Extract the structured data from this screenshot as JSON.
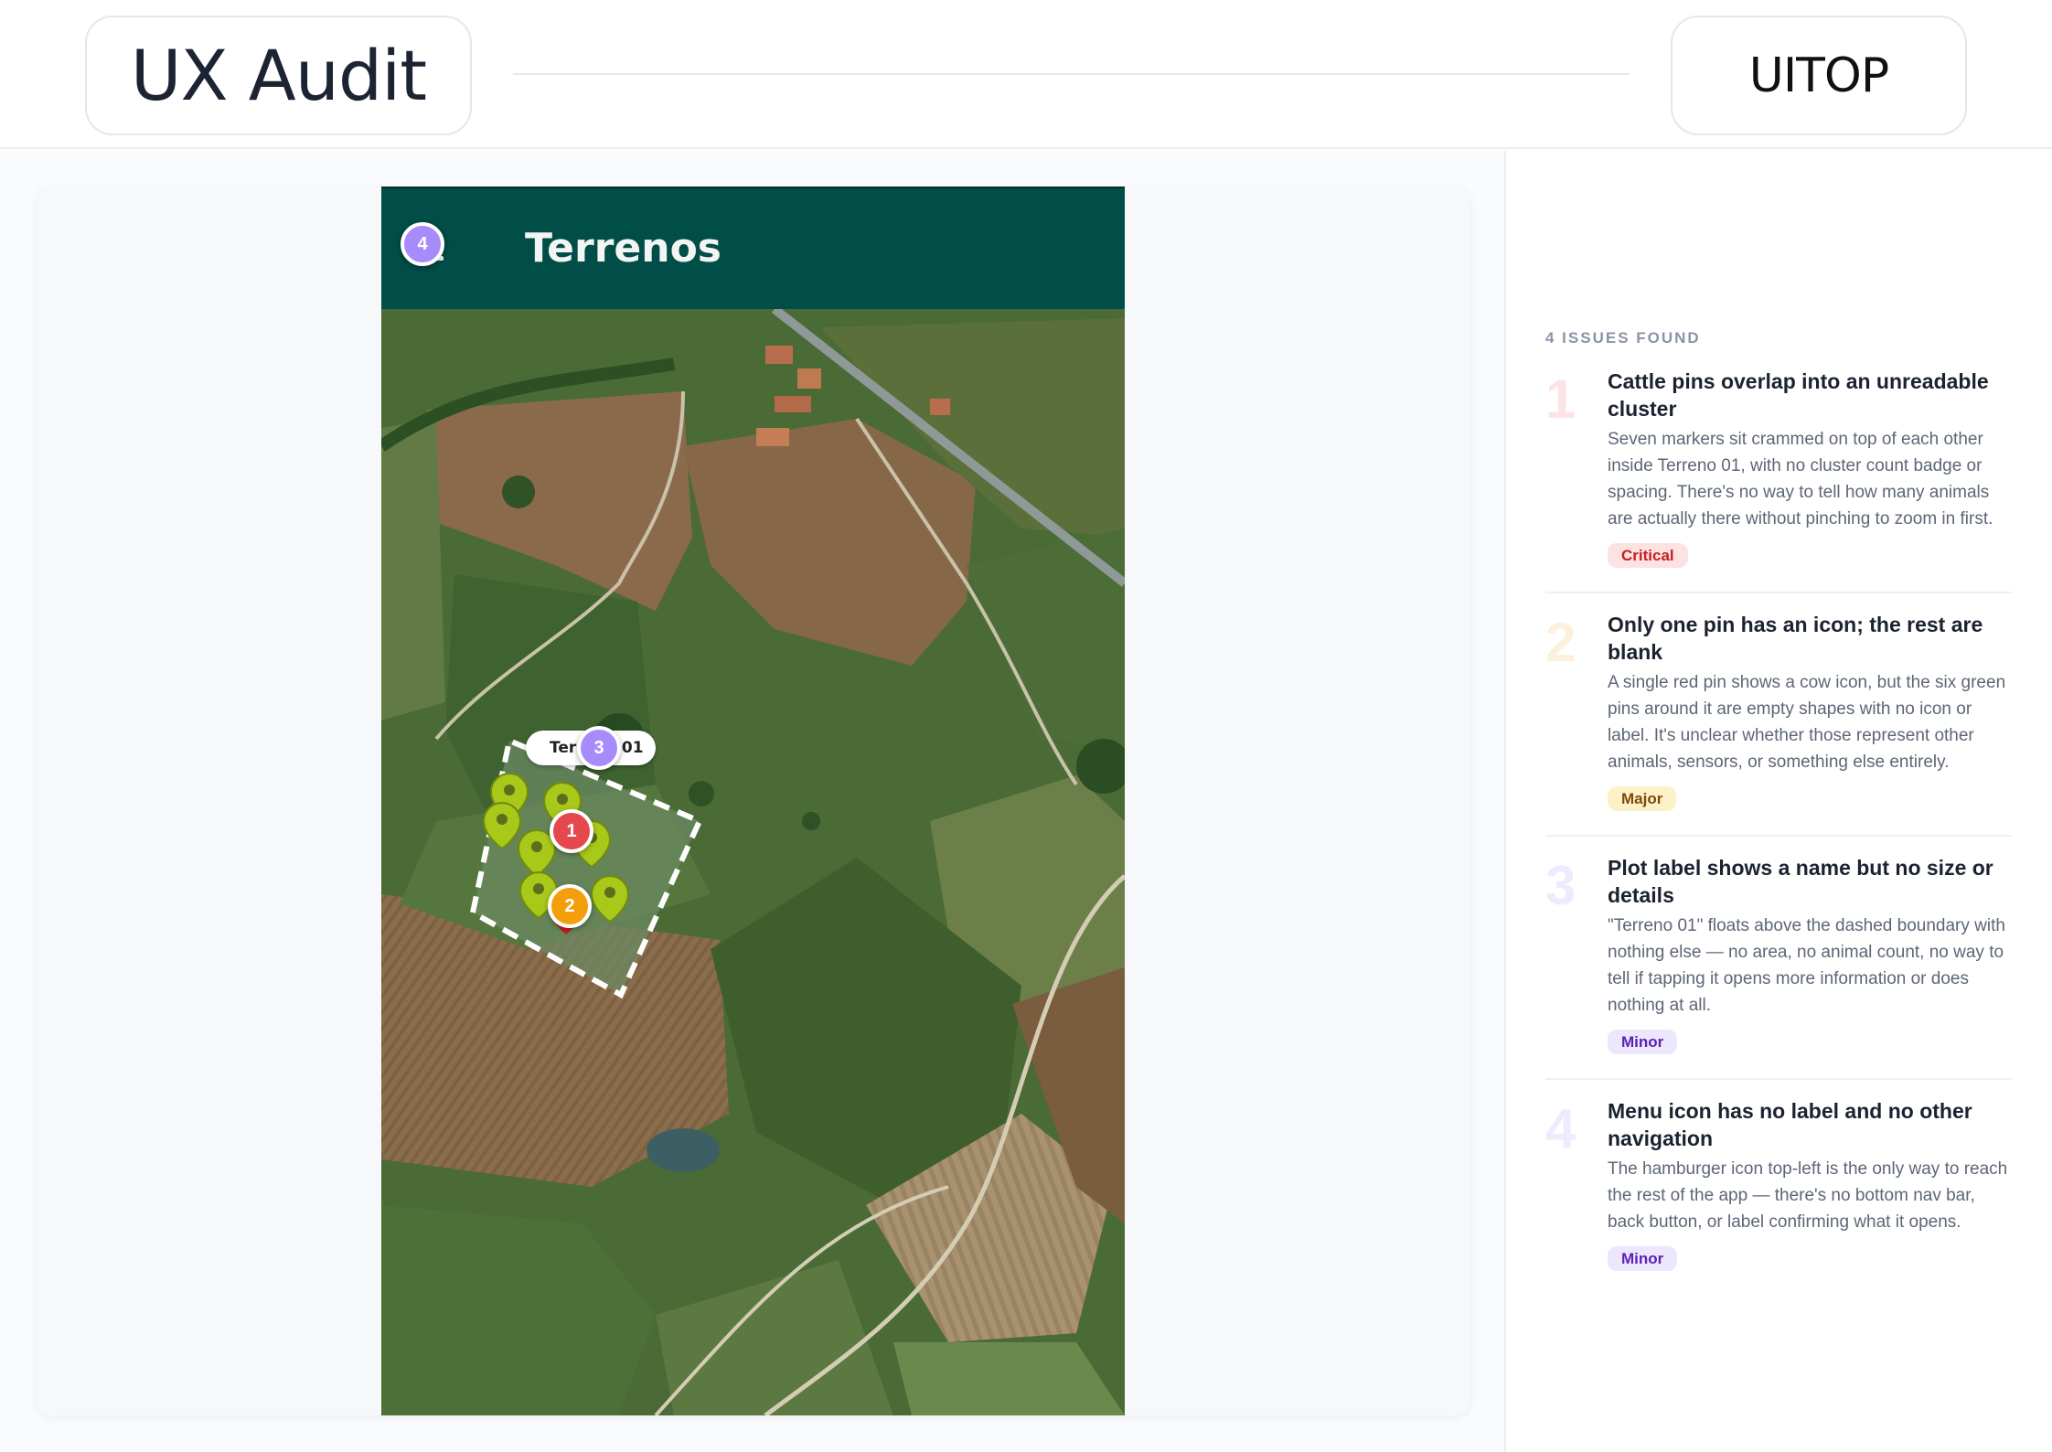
{
  "header": {
    "title": "UX Audit",
    "brand": "UITOP"
  },
  "phone": {
    "app_title": "Terrenos",
    "plot_label": "Terreno 01",
    "plot_label_visible": "Ter      01"
  },
  "markers": [
    {
      "number": "1",
      "color": "#e5484d"
    },
    {
      "number": "2",
      "color": "#f59e0b"
    },
    {
      "number": "3",
      "color": "#a78bfa"
    },
    {
      "number": "4",
      "color": "#a78bfa"
    }
  ],
  "panel": {
    "issues_count_label": "4 ISSUES FOUND",
    "issues": [
      {
        "number": "1",
        "number_color": "#fde4e4",
        "title": "Cattle pins overlap into an unreadable cluster",
        "description": "Seven markers sit crammed on top of each other inside Terreno 01, with no cluster count badge or spacing. There's no way to tell how many animals are actually there without pinching to zoom in first.",
        "severity": "Critical",
        "badge_bg": "#fde2e2",
        "badge_fg": "#c81e1e"
      },
      {
        "number": "2",
        "number_color": "#fdf0dc",
        "title": "Only one pin has an icon; the rest are blank",
        "description": "A single red pin shows a cow icon, but the six green pins around it are empty shapes with no icon or label. It's unclear whether those represent other animals, sensors, or something else entirely.",
        "severity": "Major",
        "badge_bg": "#fdf1c7",
        "badge_fg": "#7a4b0c"
      },
      {
        "number": "3",
        "number_color": "#efeafd",
        "title": "Plot label shows a name but no size or details",
        "description": "\"Terreno 01\" floats above the dashed boundary with nothing else — no area, no animal count, no way to tell if tapping it opens more information or does nothing at all.",
        "severity": "Minor",
        "badge_bg": "#ede7fd",
        "badge_fg": "#5b21b6"
      },
      {
        "number": "4",
        "number_color": "#efeafd",
        "title": "Menu icon has no label and no other navigation",
        "description": "The hamburger icon top-left is the only way to reach the rest of the app — there's no bottom nav bar, back button, or label confirming what it opens.",
        "severity": "Minor",
        "badge_bg": "#ede7fd",
        "badge_fg": "#5b21b6"
      }
    ]
  }
}
